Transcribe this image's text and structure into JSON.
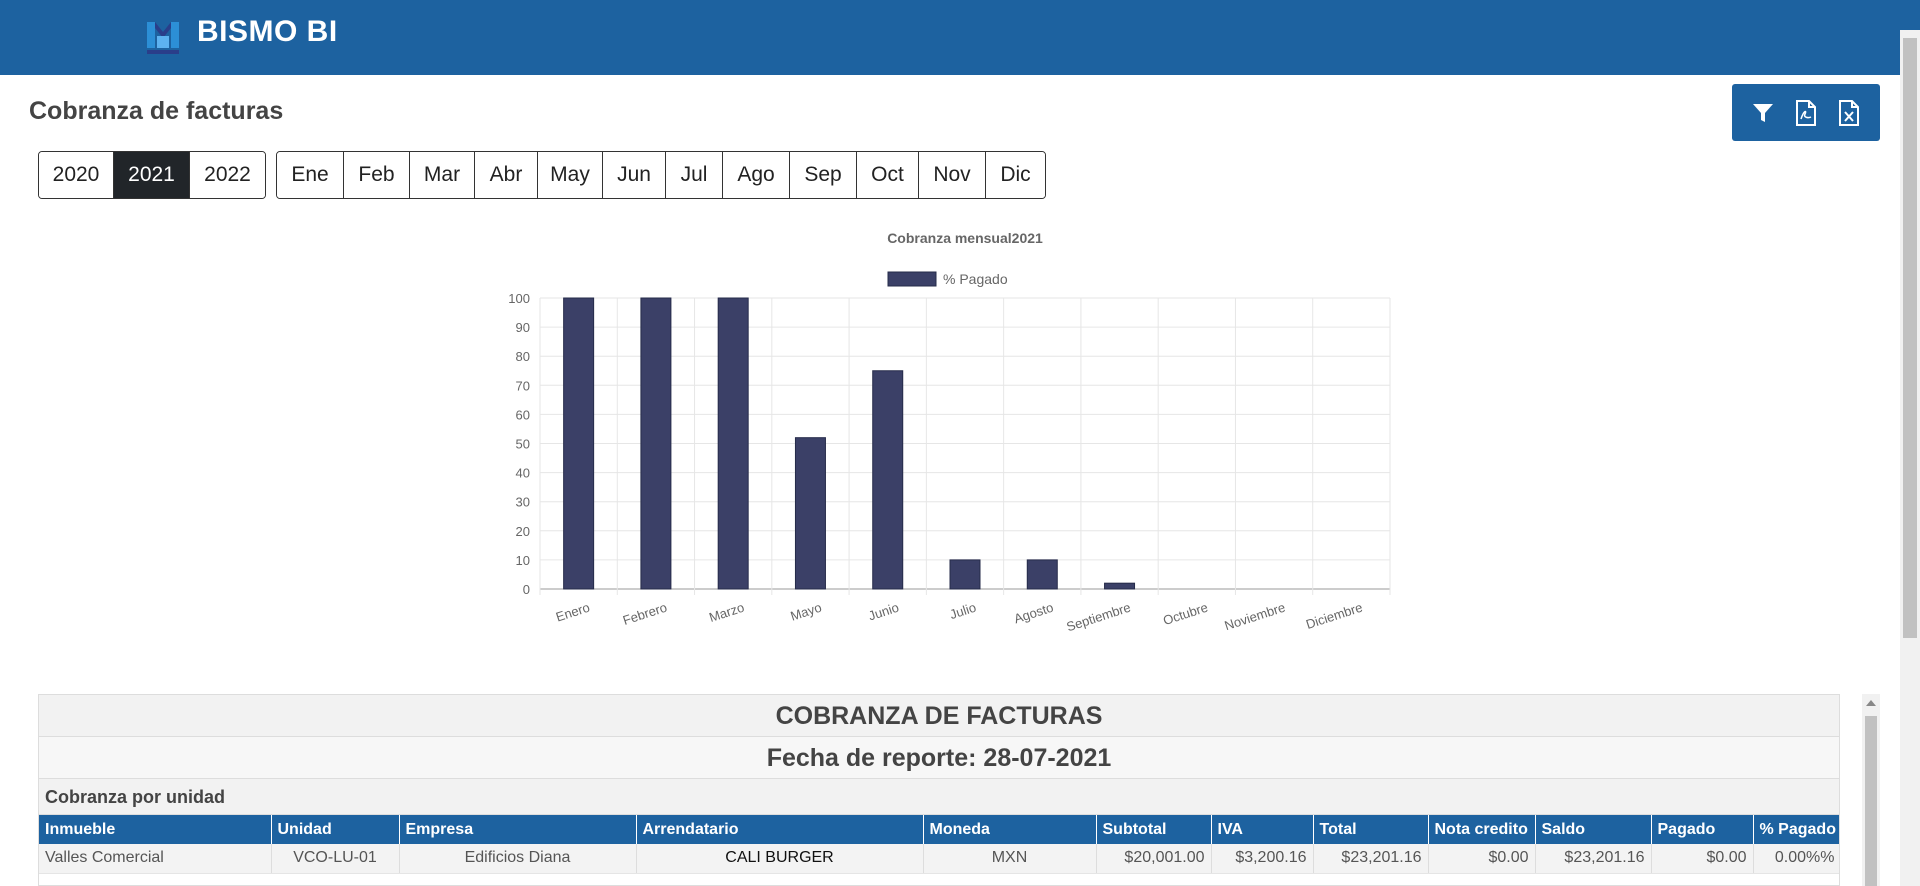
{
  "app": {
    "brand": "BISMO BI"
  },
  "page": {
    "title": "Cobranza de facturas"
  },
  "years": [
    {
      "label": "2020",
      "active": false
    },
    {
      "label": "2021",
      "active": true
    },
    {
      "label": "2022",
      "active": false
    }
  ],
  "months": [
    "Ene",
    "Feb",
    "Mar",
    "Abr",
    "May",
    "Jun",
    "Jul",
    "Ago",
    "Sep",
    "Oct",
    "Nov",
    "Dic"
  ],
  "actions": [
    {
      "name": "filter",
      "icon": "filter-icon"
    },
    {
      "name": "export-pdf",
      "icon": "file-pdf-icon"
    },
    {
      "name": "export-excel",
      "icon": "file-excel-icon"
    }
  ],
  "colors": {
    "header": "#1d62a0",
    "bar": "#3b4067",
    "bar_border": "#262b4a"
  },
  "chart_data": {
    "type": "bar",
    "title": "Cobranza mensual2021",
    "legend": "top",
    "grid": true,
    "categories": [
      "Enero",
      "Febrero",
      "Marzo",
      "Mayo",
      "Junio",
      "Julio",
      "Agosto",
      "Septiembre",
      "Octubre",
      "Noviembre",
      "Diciembre"
    ],
    "series": [
      {
        "name": "% Pagado",
        "values": [
          100,
          100,
          100,
          52,
          75,
          10,
          10,
          2,
          0,
          0,
          0
        ]
      }
    ],
    "ylim": [
      0,
      100
    ],
    "yticks": [
      0,
      10,
      20,
      30,
      40,
      50,
      60,
      70,
      80,
      90,
      100
    ]
  },
  "report": {
    "title": "COBRANZA DE FACTURAS",
    "date": "Fecha de reporte: 28-07-2021",
    "section": "Cobranza por unidad",
    "columns": [
      "Inmueble",
      "Unidad",
      "Empresa",
      "Arrendatario",
      "Moneda",
      "Subtotal",
      "IVA",
      "Total",
      "Nota credito",
      "Saldo",
      "Pagado",
      "% Pagado"
    ],
    "rows": [
      [
        "Valles Comercial",
        "VCO-LU-01",
        "Edificios Diana",
        "CALI BURGER",
        "MXN",
        "$20,001.00",
        "$3,200.16",
        "$23,201.16",
        "$0.00",
        "$23,201.16",
        "$0.00",
        "0.00%%"
      ]
    ]
  }
}
